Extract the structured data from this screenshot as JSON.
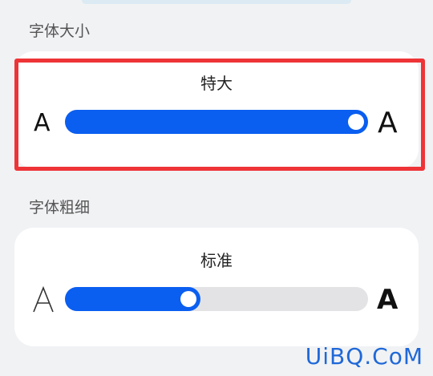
{
  "font_size": {
    "section_title": "字体大小",
    "value_label": "特大",
    "small_glyph": "A",
    "large_glyph": "A",
    "slider_level_percent": 100
  },
  "font_weight": {
    "section_title": "字体粗细",
    "value_label": "标准",
    "light_glyph": "A",
    "bold_glyph": "A",
    "slider_level_percent": 40
  },
  "colors": {
    "accent": "#0a5ef0",
    "track": "#e3e3e5",
    "highlight": "#ee3437",
    "background": "#f1f2f4",
    "card": "#ffffff",
    "watermark": "#1f68d8"
  },
  "watermark": {
    "text": "UiBQ.CoM"
  }
}
